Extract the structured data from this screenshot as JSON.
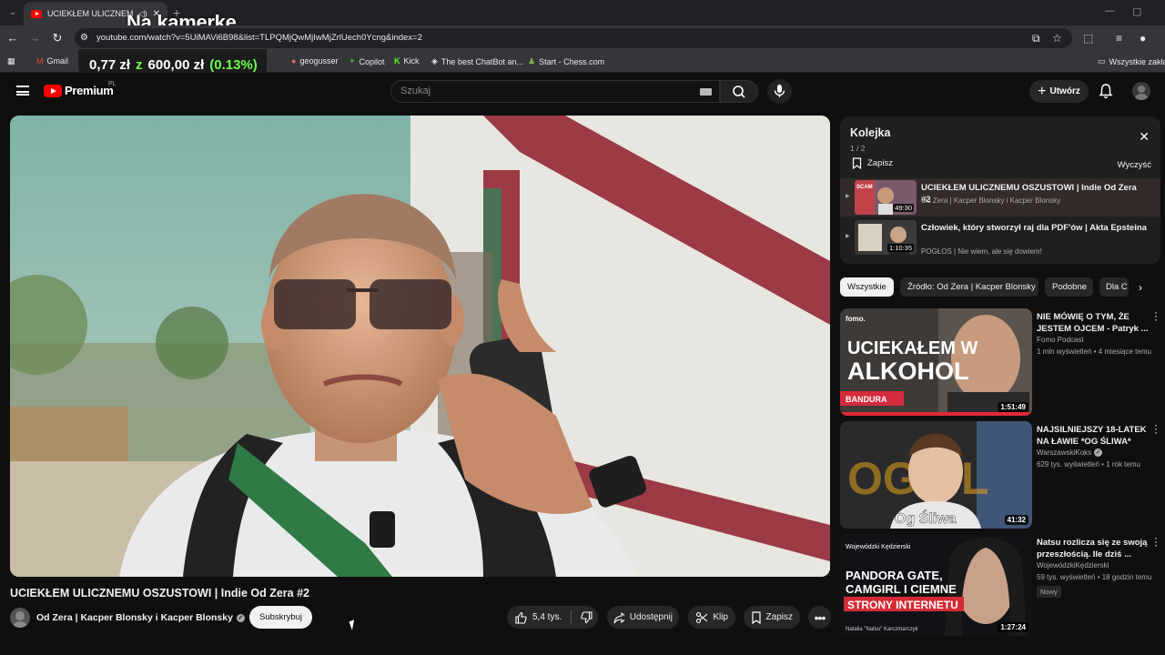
{
  "browser": {
    "tab_title": "UCIEKŁEM ULICZNEMU OS",
    "url": "youtube.com/watch?v=5UiMAVi6B98&list=TLPQMjQwMjIwMjZrlUech0Ycng&index=2",
    "bookmarks": [
      "Gmail",
      "geogusser",
      "Copilot",
      "Kick",
      "The best ChatBot an...",
      "Start - Chess.com"
    ],
    "all_bookmarks": "Wszystkie zakład"
  },
  "overlay": {
    "title": "Na kamerke",
    "price": "0,77 zł",
    "z": "z",
    "goal": "600,00 zł",
    "percent": "(0.13%)"
  },
  "masthead": {
    "brand": "Premium",
    "country": "PL",
    "search_placeholder": "Szukaj",
    "create_label": "Utwórz"
  },
  "video": {
    "title": "UCIEKŁEM ULICZNEMU OSZUSTOWI | Indie Od Zera #2",
    "channel": "Od Zera | Kacper Blonsky i Kacper Blonsky",
    "subscribe": "Subskrybuj",
    "likes": "5,4 tys.",
    "share": "Udostępnij",
    "clip": "Klip",
    "save": "Zapisz"
  },
  "queue": {
    "title": "Kolejka",
    "count": "1 / 2",
    "save": "Zapisz",
    "clear": "Wyczyść",
    "items": [
      {
        "title": "UCIEKŁEM ULICZNEMU OSZUSTOWI | Indie Od Zera #2",
        "channel": "Od Zera | Kacper Blonsky i Kacper Blonsky",
        "duration": "49:30"
      },
      {
        "title": "Człowiek, który stworzył raj dla PDF'ów | Akta Epsteina",
        "channel": "POGŁOS | Nie wiem, ale się dowiem!",
        "duration": "1:10:35"
      }
    ]
  },
  "chips": [
    "Wszystkie",
    "Źródło: Od Zera | Kacper Blonsky",
    "Podobne",
    "Dla C"
  ],
  "recommendations": [
    {
      "title": "NIE MÓWIĘ O TYM, ŻE JESTEM OJCEM - Patryk ...",
      "channel": "Fomo Podcast",
      "meta": "1 mln wyświetleń • 4 miesiące temu",
      "duration": "1:51:49",
      "thumb_text": "UCIEKAŁEM W ALKOHOL",
      "thumb_tag": "BANDURA",
      "thumb_logo": "fomo."
    },
    {
      "title": "NAJSILNIEJSZY 18-LATEK NA ŁAWIE *OG ŚLIWA*",
      "channel": "WarszawskiKoks",
      "meta": "629 tys. wyświetleń • 1 rok temu",
      "duration": "41:32",
      "thumb_text": "Og Śliwa"
    },
    {
      "title": "Natsu rozlicza się ze swoją przeszłością. Ile dziś ...",
      "channel": "WojewódzkiKędzierski",
      "meta": "59 tys. wyświetleń • 18 godzin temu",
      "badge": "Nowy",
      "duration": "1:27:24",
      "thumb_text": "PANDORA GATE, CAMGIRL I CIEMNE STRONY INTERNETU",
      "thumb_logo": "Wojewódzki Kędzierski",
      "thumb_caption": "Natalia \"Natsu\" Karczmarczyk"
    }
  ]
}
